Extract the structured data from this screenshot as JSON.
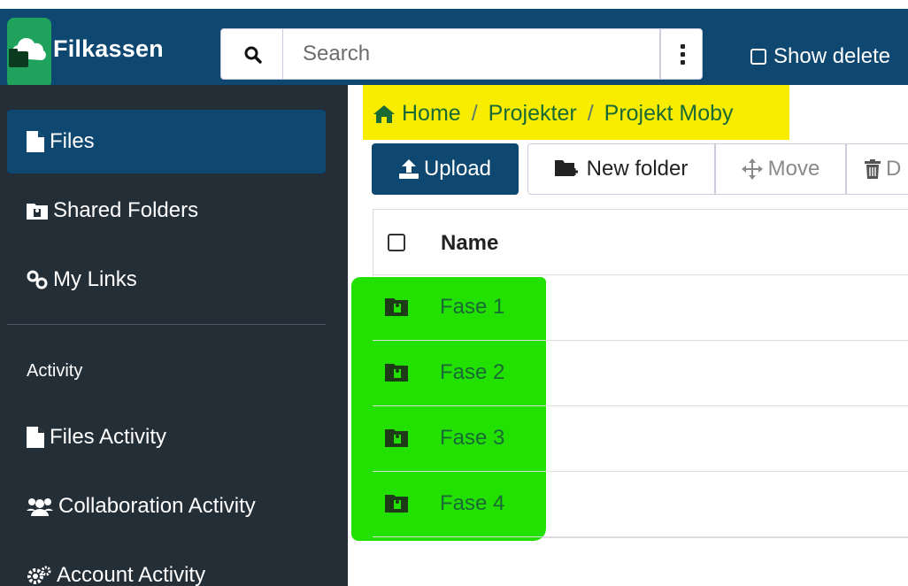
{
  "app": {
    "name": "Filkassen",
    "logo_icon": "cloud-folder-icon",
    "brand_color": "#1fa35c",
    "navbar_color": "#0e4770"
  },
  "search": {
    "placeholder": "Search",
    "value": ""
  },
  "header": {
    "show_deleted_label": "Show delete"
  },
  "sidebar": {
    "items": [
      {
        "label": "Files",
        "icon": "file-icon",
        "active": true
      },
      {
        "label": "Shared Folders",
        "icon": "shared-folder-icon",
        "active": false
      },
      {
        "label": "My Links",
        "icon": "link-icon",
        "active": false
      }
    ],
    "activity_heading": "Activity",
    "activity_items": [
      {
        "label": "Files Activity",
        "icon": "file-icon"
      },
      {
        "label": "Collaboration Activity",
        "icon": "users-icon"
      },
      {
        "label": "Account Activity",
        "icon": "gears-icon"
      }
    ]
  },
  "breadcrumb": {
    "items": [
      "Home",
      "Projekter",
      "Projekt Moby"
    ],
    "separator": "/"
  },
  "toolbar": {
    "upload_label": "Upload",
    "new_folder_label": "New folder",
    "move_label": "Move",
    "delete_label": "D"
  },
  "table": {
    "name_header": "Name",
    "rows": [
      {
        "name": "Fase 1",
        "icon": "shared-folder-icon"
      },
      {
        "name": "Fase 2",
        "icon": "shared-folder-icon"
      },
      {
        "name": "Fase 3",
        "icon": "shared-folder-icon"
      },
      {
        "name": "Fase 4",
        "icon": "shared-folder-icon"
      }
    ]
  },
  "highlights": {
    "breadcrumb_color": "#f8ec00",
    "rows_color": "#22e000"
  }
}
